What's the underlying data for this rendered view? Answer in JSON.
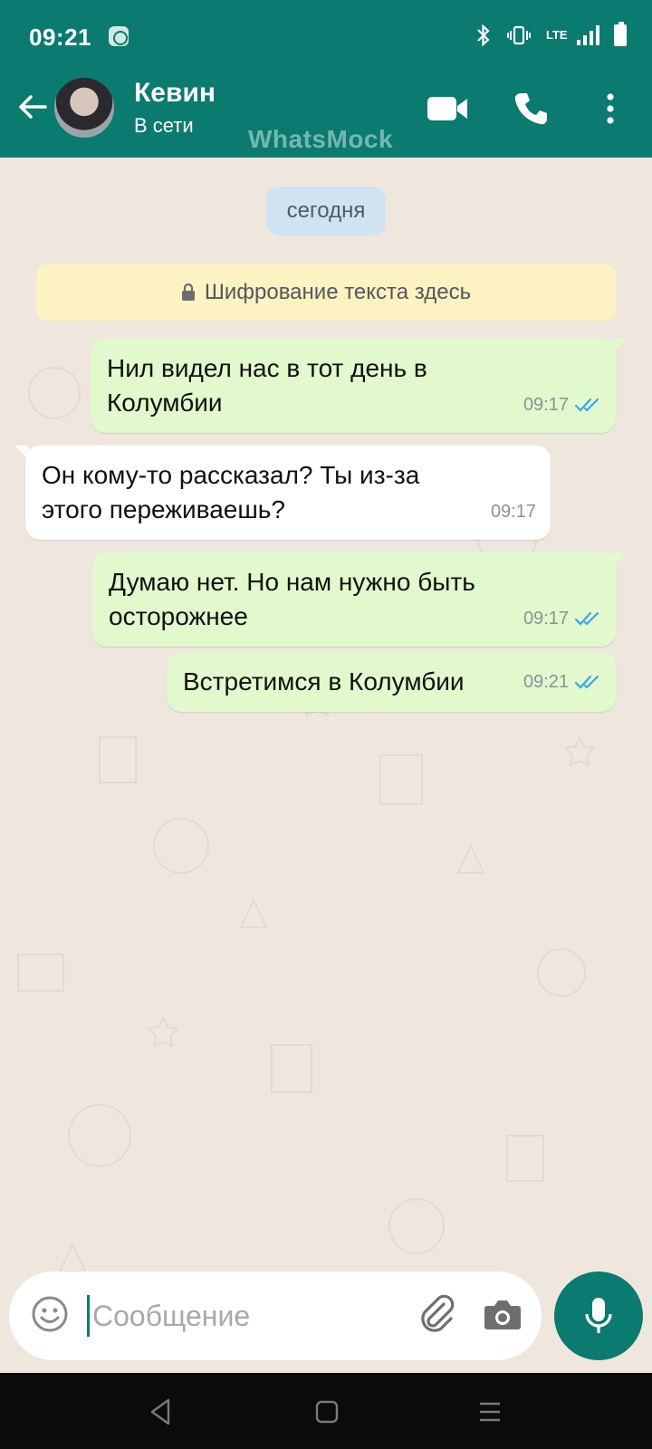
{
  "status_bar": {
    "time": "09:21",
    "network_label": "LTE"
  },
  "header": {
    "contact_name": "Кевин",
    "contact_status": "В сети",
    "watermark": "WhatsMock"
  },
  "chat": {
    "date_chip": "сегодня",
    "encryption_note": "Шифрование текста здесь",
    "messages": [
      {
        "direction": "out",
        "text": "Нил видел нас в тот день в Колумбии",
        "time": "09:17",
        "read": true
      },
      {
        "direction": "in",
        "text": "Он кому-то рассказал? Ты из-за этого переживаешь?",
        "time": "09:17"
      },
      {
        "direction": "out",
        "text": "Думаю нет. Но нам нужно быть осторожнее",
        "time": "09:17",
        "read": true
      },
      {
        "direction": "out",
        "text": "Встретимся в Колумбии",
        "time": "09:21",
        "read": true
      }
    ]
  },
  "composer": {
    "placeholder": "Сообщение",
    "value": ""
  },
  "colors": {
    "header": "#0b7a6f",
    "chat_bg": "#efe7de",
    "outgoing_bubble": "#e2f8cd",
    "incoming_bubble": "#ffffff",
    "read_ticks": "#3aa7e6",
    "date_chip": "#cfe3f3",
    "encryption_note": "#fdf2c2"
  },
  "icons": [
    "back-arrow-icon",
    "video-call-icon",
    "phone-icon",
    "more-vert-icon",
    "lock-icon",
    "emoji-icon",
    "attach-icon",
    "camera-icon",
    "mic-icon",
    "double-check-icon",
    "nav-back-icon",
    "nav-home-icon",
    "nav-recents-icon",
    "bluetooth-icon",
    "vibrate-icon",
    "signal-icon",
    "battery-icon"
  ]
}
